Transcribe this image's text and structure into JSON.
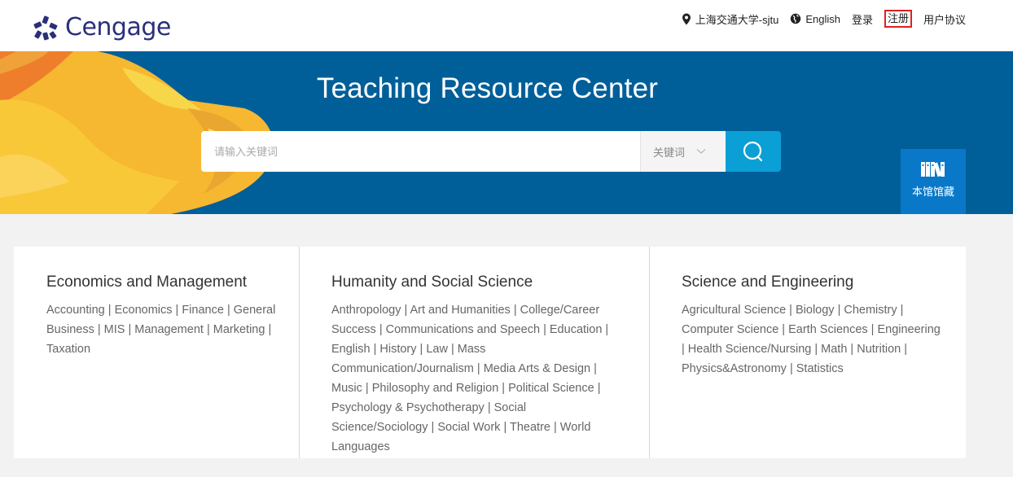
{
  "header": {
    "logo_text": "Cengage",
    "nav": {
      "institution": "上海交通大学-sjtu",
      "language": "English",
      "login": "登录",
      "register": "注册",
      "user_agreement": "用户协议"
    },
    "icons": [
      "location-pin-icon",
      "globe-icon"
    ]
  },
  "hero": {
    "title": "Teaching Resource Center",
    "search": {
      "placeholder": "请输入关键词",
      "value": "",
      "scope_selected": "关键词",
      "button_icon": "search-icon"
    },
    "holdings_button": {
      "label": "本馆馆藏",
      "icon": "books-icon"
    }
  },
  "categories": [
    {
      "title": "Economics and Management",
      "links": [
        "Accounting",
        "Economics",
        "Finance",
        "General Business",
        "MIS",
        "Management",
        "Marketing",
        "Taxation"
      ]
    },
    {
      "title": "Humanity and Social Science",
      "links": [
        "Anthropology",
        "Art and Humanities",
        "College/Career Success",
        "Communications and Speech",
        "Education",
        "English",
        "History",
        "Law",
        "Mass Communication/Journalism",
        "Media Arts & Design",
        "Music",
        "Philosophy and Religion",
        "Political Science",
        "Psychology & Psychotherapy",
        "Social Science/Sociology",
        "Social Work",
        "Theatre",
        "World Languages"
      ]
    },
    {
      "title": "Science and Engineering",
      "links": [
        "Agricultural Science",
        "Biology",
        "Chemistry",
        "Computer Science",
        "Earth Sciences",
        "Engineering",
        "Health Science/Nursing",
        "Math",
        "Nutrition",
        "Physics&Astronomy",
        "Statistics"
      ]
    }
  ],
  "colors": {
    "brand": "#2a2f7c",
    "hero_background": "#005f99",
    "search_button": "#0aa0d6",
    "holdings_button": "#0a78c8",
    "register_highlight": "#e02020"
  }
}
